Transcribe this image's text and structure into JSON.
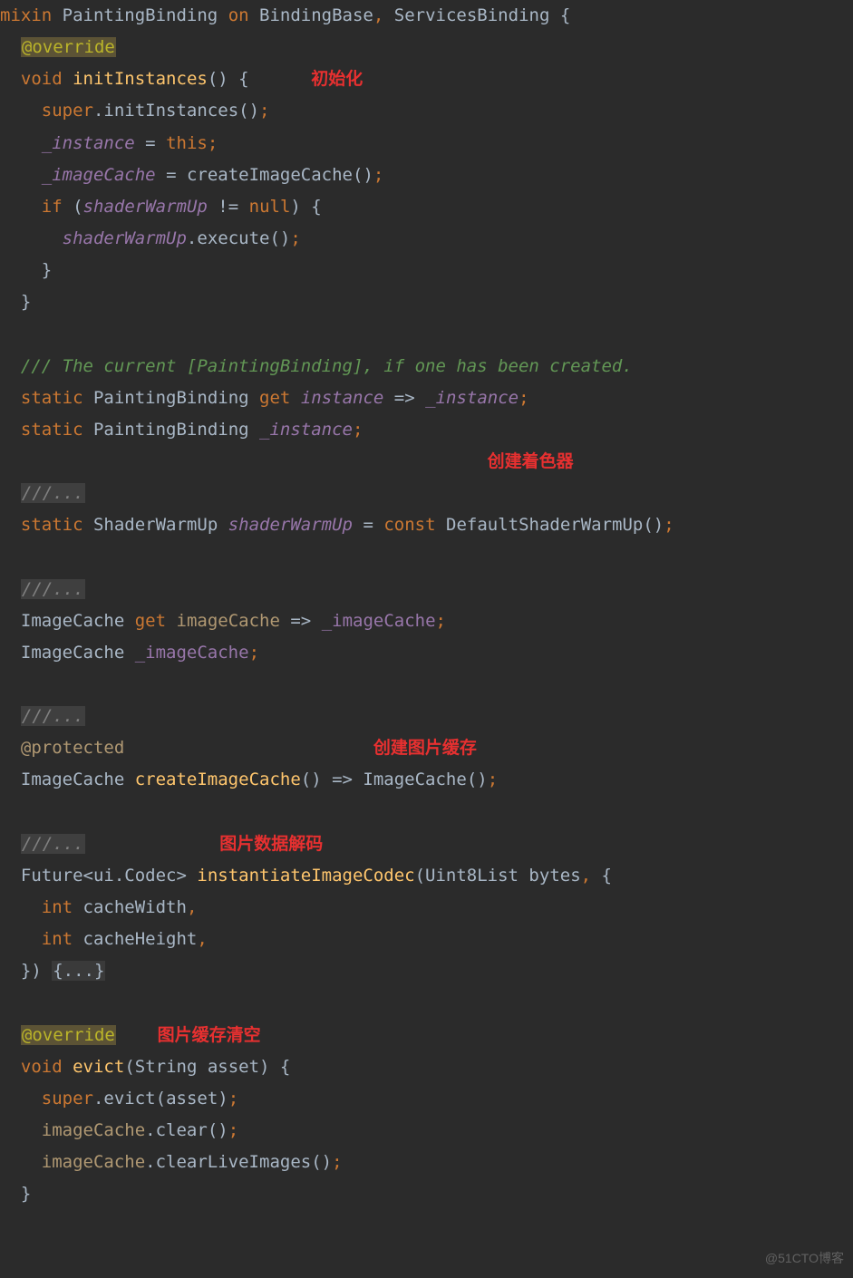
{
  "code": {
    "l1": {
      "mixin": "mixin",
      "class": "PaintingBinding",
      "on": "on",
      "base1": "BindingBase",
      "base2": "ServicesBinding"
    },
    "override": "@override",
    "initInstances": {
      "kw": "void",
      "name": "initInstances",
      "note": "初始化",
      "super": "super",
      "call": "initInstances"
    },
    "instanceAssign": {
      "field": "_instance",
      "this": "this"
    },
    "imageCacheAssign": {
      "field": "_imageCache",
      "call": "createImageCache"
    },
    "ifStmt": {
      "if": "if",
      "field": "shaderWarmUp",
      "null": "null"
    },
    "shaderExec": {
      "field": "shaderWarmUp",
      "call": "execute"
    },
    "docComment": "/// The current [PaintingBinding], if one has been created.",
    "getter": {
      "static": "static",
      "type": "PaintingBinding",
      "get": "get",
      "name": "instance",
      "ret": "_instance"
    },
    "staticInstance": {
      "static": "static",
      "type": "PaintingBinding",
      "name": "_instance"
    },
    "ellipsis": "///...",
    "shaderNote": "创建着色器",
    "shaderWarmUpDecl": {
      "static": "static",
      "type": "ShaderWarmUp",
      "name": "shaderWarmUp",
      "const": "const",
      "ctor": "DefaultShaderWarmUp"
    },
    "imageCacheGetter": {
      "type": "ImageCache",
      "get": "get",
      "name": "imageCache",
      "ret": "_imageCache"
    },
    "imageCacheField": {
      "type": "ImageCache",
      "name": "_imageCache"
    },
    "protected": "@protected",
    "createNote": "创建图片缓存",
    "createImageCache": {
      "type": "ImageCache",
      "name": "createImageCache",
      "ctor": "ImageCache"
    },
    "decodeNote": "图片数据解码",
    "instantiate": {
      "ret": "Future<ui.Codec>",
      "name": "instantiateImageCodec",
      "param1": "Uint8List bytes",
      "p2": "int",
      "p2n": "cacheWidth",
      "p3": "int",
      "p3n": "cacheHeight",
      "fold": "{...}"
    },
    "clearNote": "图片缓存清空",
    "evict": {
      "kw": "void",
      "name": "evict",
      "param": "String asset",
      "super": "super",
      "call": "evict",
      "arg": "asset",
      "ic": "imageCache",
      "clear": "clear",
      "clearLive": "clearLiveImages"
    }
  },
  "watermark": "@51CTO博客"
}
